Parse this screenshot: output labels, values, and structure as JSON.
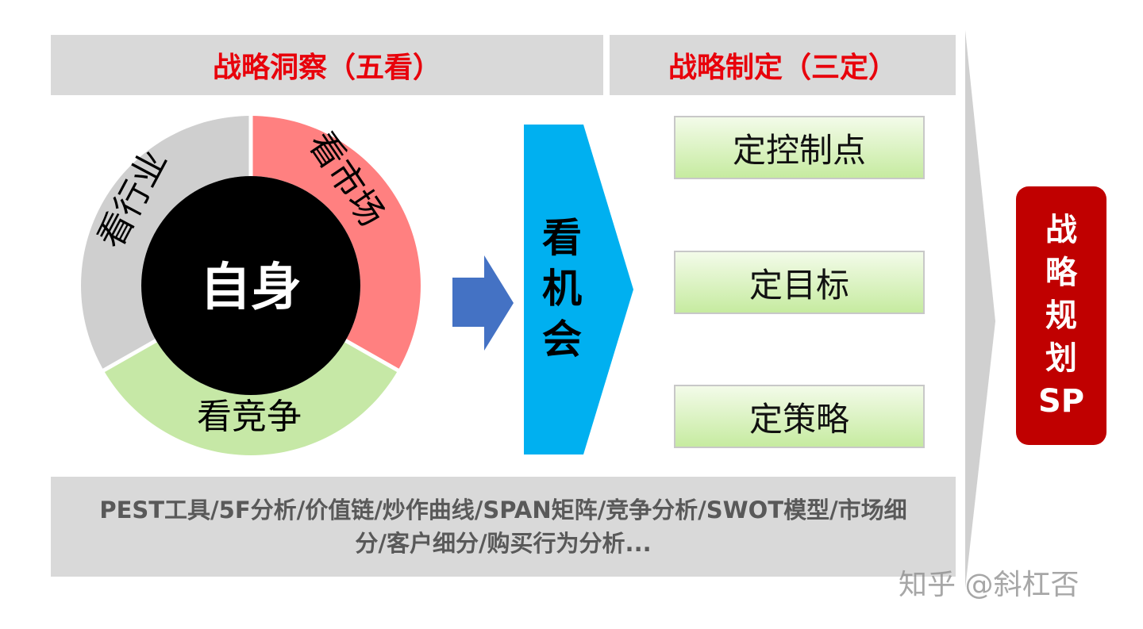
{
  "headers": {
    "insight": "战略洞察（五看）",
    "formulation": "战略制定（三定）"
  },
  "wheel": {
    "center": "自身",
    "segments": [
      {
        "label": "看行业",
        "color": "#cfcfcf"
      },
      {
        "label": "看市场",
        "color": "#ff8080"
      },
      {
        "label": "看竞争",
        "color": "#c6e8a6"
      }
    ],
    "center_color": "#000000"
  },
  "opportunity": {
    "chars": [
      "看",
      "机",
      "会"
    ],
    "color": "#00b0f0",
    "arrow_color": "#4472c4"
  },
  "decisions": [
    "定控制点",
    "定目标",
    "定策略"
  ],
  "result": {
    "chars": [
      "战",
      "略",
      "规",
      "划",
      "SP"
    ],
    "color": "#c00000"
  },
  "tools": {
    "line1": "PEST工具/5F分析/价值链/炒作曲线/SPAN矩阵/竞争分析/SWOT模型/市场细",
    "line2": "分/客户细分/购买行为分析..."
  },
  "watermark": "知乎 @斜杠否"
}
